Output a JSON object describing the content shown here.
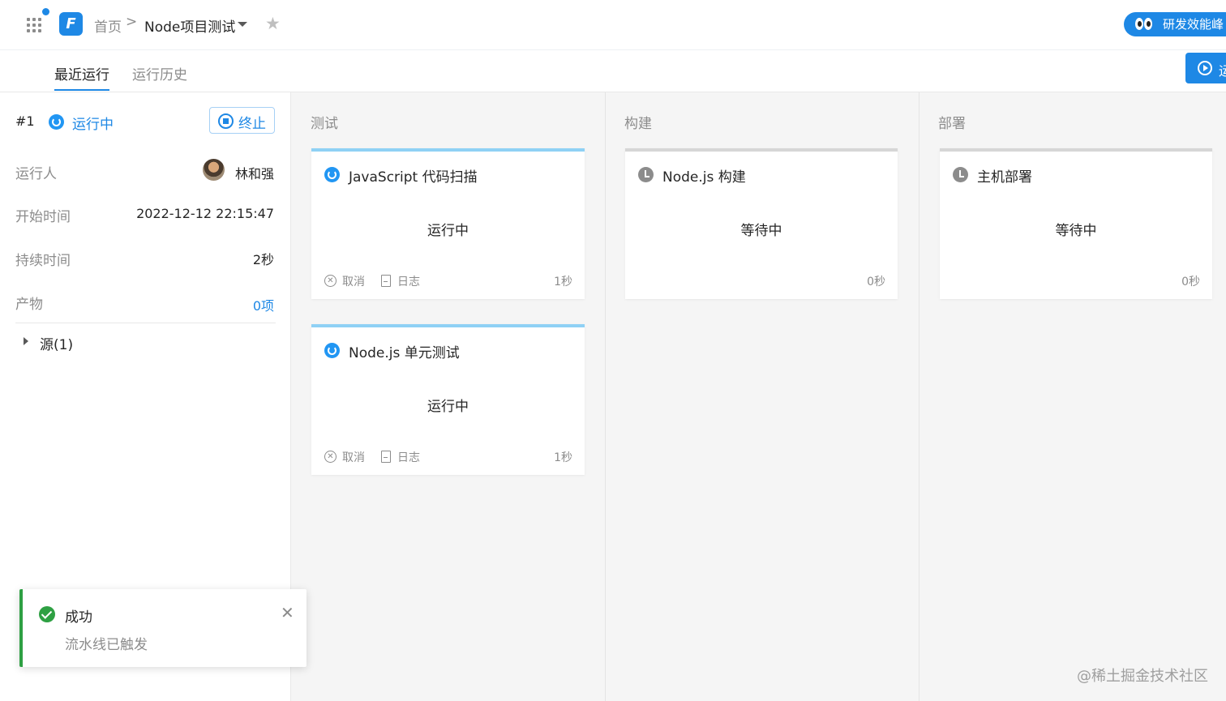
{
  "topbar": {
    "logo_letter": "F",
    "breadcrumb_home": "首页",
    "breadcrumb_separator": ">",
    "project_name": "Node项目测试",
    "promo_text": "研发效能峰"
  },
  "tabs": [
    {
      "label": "最近运行",
      "active": true
    },
    {
      "label": "运行历史",
      "active": false
    }
  ],
  "run_button_label": "运",
  "run": {
    "number": "#1",
    "status": "运行中",
    "stop_label": "终止",
    "rows": [
      {
        "label": "运行人",
        "value": "林和强"
      },
      {
        "label": "开始时间",
        "value": "2022-12-12 22:15:47"
      },
      {
        "label": "持续时间",
        "value": "2秒"
      },
      {
        "label": "产物",
        "value": "0项"
      }
    ],
    "source_label": "源(1)"
  },
  "stages": [
    {
      "title": "测试",
      "jobs": [
        {
          "name": "JavaScript 代码扫描",
          "status": "运行中",
          "state": "running",
          "cancel_label": "取消",
          "log_label": "日志",
          "duration": "1秒"
        },
        {
          "name": "Node.js 单元测试",
          "status": "运行中",
          "state": "running",
          "cancel_label": "取消",
          "log_label": "日志",
          "duration": "1秒"
        }
      ]
    },
    {
      "title": "构建",
      "jobs": [
        {
          "name": "Node.js 构建",
          "status": "等待中",
          "state": "waiting",
          "duration": "0秒"
        }
      ]
    },
    {
      "title": "部署",
      "jobs": [
        {
          "name": "主机部署",
          "status": "等待中",
          "state": "waiting",
          "duration": "0秒"
        }
      ]
    }
  ],
  "toast": {
    "title": "成功",
    "message": "流水线已触发",
    "close_glyph": "✕"
  },
  "watermark": "@稀土掘金技术社区",
  "colors": {
    "accent": "#1e88e5",
    "success": "#2ea043",
    "running_bar": "#8fd1f5",
    "waiting_bar": "#d6d6d6"
  },
  "icons": {
    "apps": "grid-icon",
    "star": "star-icon",
    "running": "spinner-icon",
    "waiting": "clock-icon",
    "cancel": "cancel-circle-icon",
    "log": "log-icon",
    "stop": "stop-circle-icon",
    "play": "play-circle-icon"
  }
}
